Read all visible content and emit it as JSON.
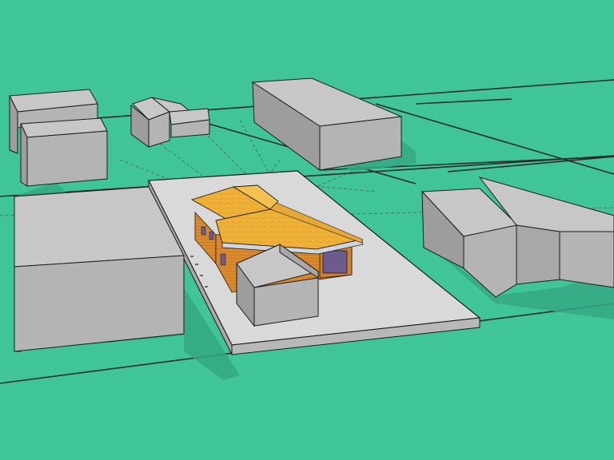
{
  "scene": {
    "description_free": true,
    "colors": {
      "ground": "#3fc597",
      "building_top": "#c7c7c7",
      "building_left": "#9d9d9d",
      "building_right": "#b4b4b4",
      "outline": "#1b1b1b",
      "shadow": "#2f9f77",
      "lot_top": "#d9d9d9",
      "lot_edge": "#9e9e9e",
      "house_wall": "#d98a2e",
      "house_wall_dark": "#b66e1d",
      "house_roof": "#f0b338",
      "house_roof_edge": "#cfd6de",
      "window": "#6b5b8f",
      "property_line": "#2a2a2a"
    }
  }
}
